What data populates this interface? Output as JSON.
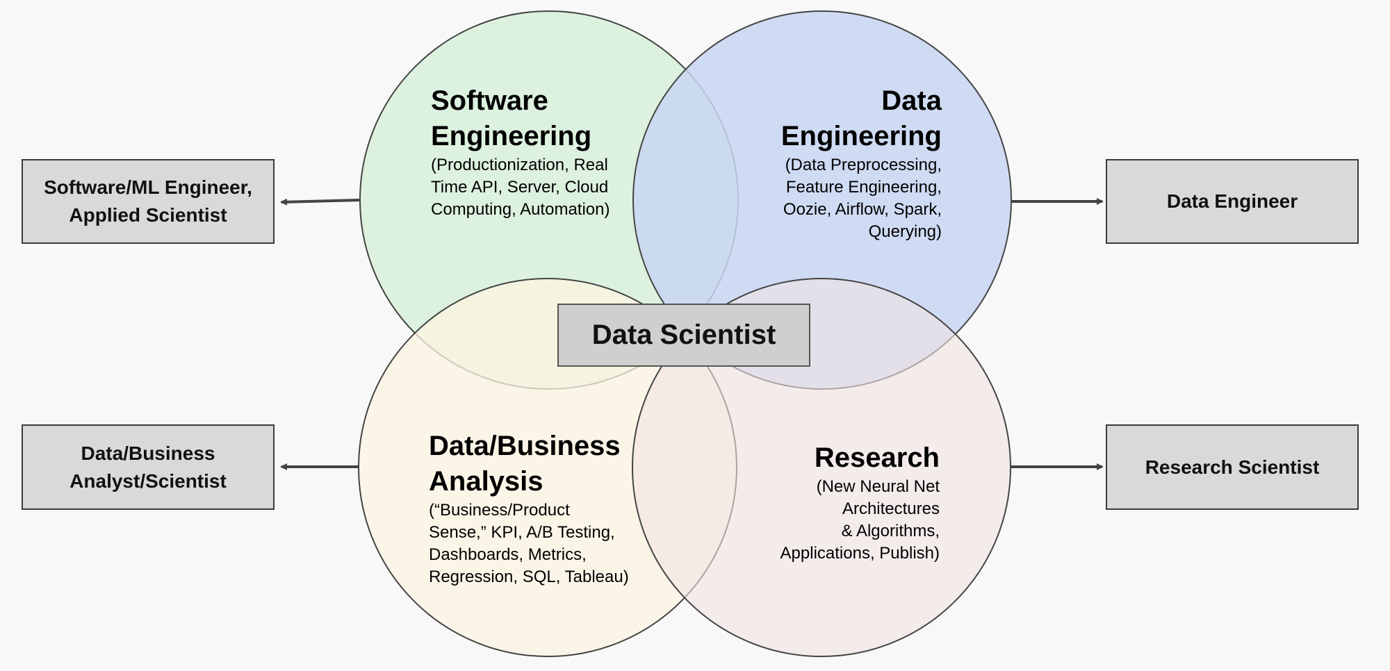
{
  "colors": {
    "background": "#f8f8f8",
    "software_engineering": "#d9f0dc",
    "data_engineering": "#c8d6f2",
    "data_business_analysis": "#fbf4e2",
    "research": "#f1e3e3",
    "role_box": "#d9d9d9",
    "center_box": "#cfcfcf",
    "arrow": "#444444"
  },
  "domains": {
    "software_engineering": {
      "title": [
        "Software",
        "Engineering"
      ],
      "desc": [
        "(Productionization, Real",
        "Time API, Server, Cloud",
        "Computing, Automation)"
      ]
    },
    "data_engineering": {
      "title": [
        "Data",
        "Engineering"
      ],
      "desc": [
        "(Data Preprocessing,",
        "Feature Engineering,",
        "Oozie, Airflow, Spark,",
        "Querying)"
      ]
    },
    "data_business_analysis": {
      "title": [
        "Data/Business",
        "Analysis"
      ],
      "desc": [
        "(“Business/Product",
        "Sense,” KPI, A/B Testing,",
        "Dashboards, Metrics,",
        "Regression, SQL, Tableau)"
      ]
    },
    "research": {
      "title": [
        "Research"
      ],
      "desc": [
        "(New Neural Net",
        "Architectures",
        "& Algorithms,",
        "Applications, Publish)"
      ]
    }
  },
  "center": {
    "label": "Data Scientist"
  },
  "roles": {
    "software_ml_engineer": [
      "Software/ML Engineer,",
      "Applied Scientist"
    ],
    "data_engineer": [
      "Data Engineer"
    ],
    "data_business_analyst": [
      "Data/Business",
      "Analyst/Scientist"
    ],
    "research_scientist": [
      "Research Scientist"
    ]
  }
}
